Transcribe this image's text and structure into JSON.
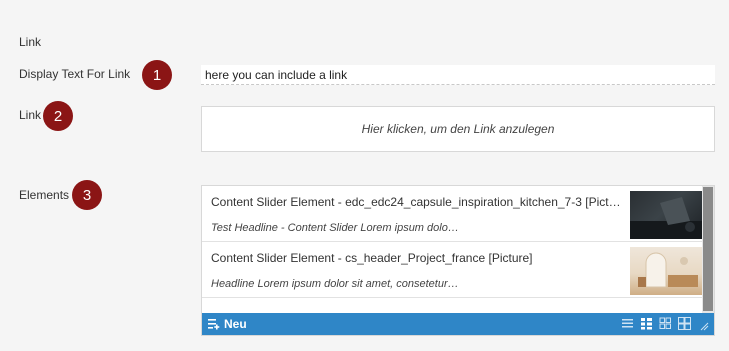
{
  "section_title": "Link",
  "display_text": {
    "label": "Display Text For Link",
    "value": "here you can include a link",
    "badge": "1"
  },
  "link": {
    "label": "Link",
    "placeholder_text": "Hier klicken, um den Link anzulegen",
    "badge": "2"
  },
  "elements": {
    "label": "Elements",
    "badge": "3",
    "items": [
      {
        "title": "Content Slider Element - edc_edc24_capsule_inspiration_kitchen_7-3 [Pict…",
        "subtitle": "Test Headline - Content Slider Lorem ipsum dolo…"
      },
      {
        "title": "Content Slider Element - cs_header_Project_france [Picture]",
        "subtitle": "Headline Lorem ipsum dolor sit amet, consetetur…"
      }
    ],
    "toolbar": {
      "new_label": "Neu",
      "icons": [
        "list-view-icon",
        "compact-grid-icon",
        "grid-icon",
        "large-grid-icon",
        "resize-icon"
      ]
    }
  },
  "colors": {
    "badge": "#8b1515",
    "toolbar": "#2f86c7",
    "background": "#f5f5f5"
  }
}
